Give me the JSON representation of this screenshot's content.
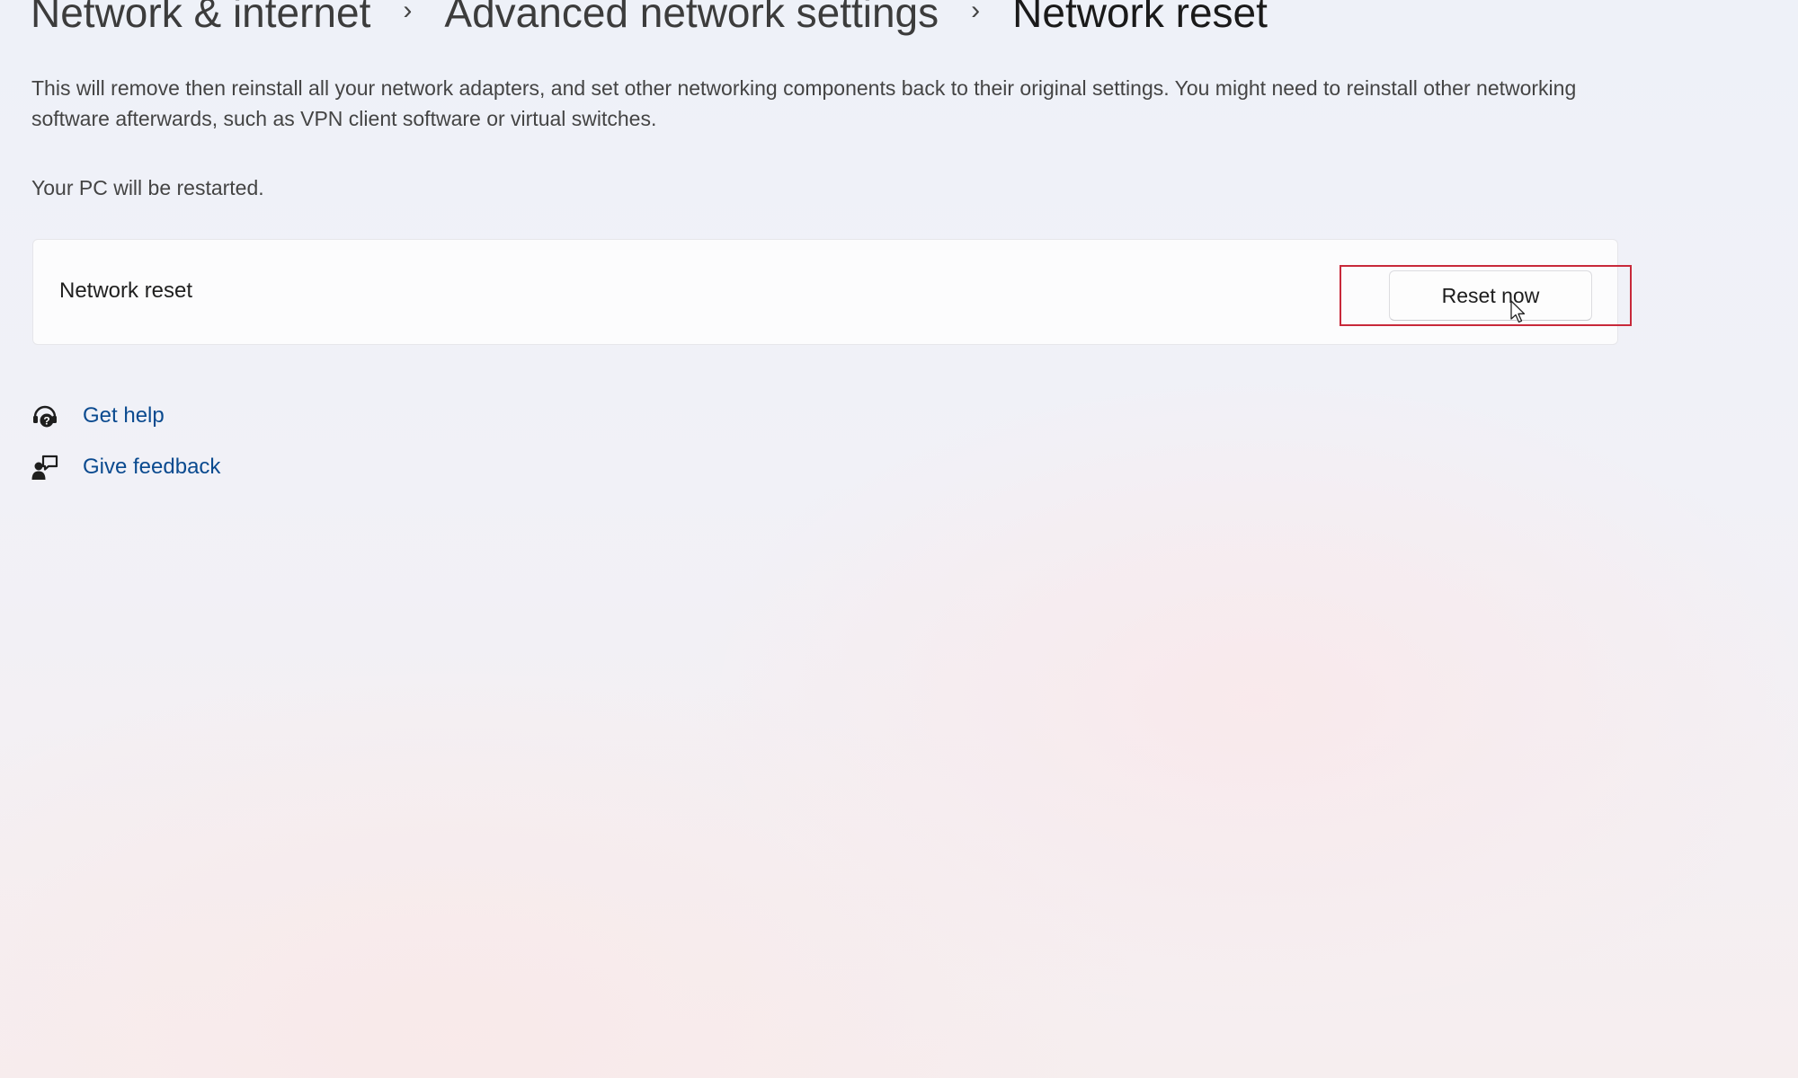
{
  "breadcrumb": {
    "items": [
      "Network & internet",
      "Advanced network settings",
      "Network reset"
    ],
    "separator": "›"
  },
  "description": "This will remove then reinstall all your network adapters, and set other networking components back to their original settings. You might need to reinstall other networking software afterwards, such as VPN client software or virtual switches.",
  "restart_note": "Your PC will be restarted.",
  "network_reset_card": {
    "label": "Network reset",
    "button_label": "Reset now"
  },
  "links": {
    "get_help": {
      "label": "Get help",
      "icon": "get-help-icon"
    },
    "give_feedback": {
      "label": "Give feedback",
      "icon": "feedback-icon"
    }
  },
  "colors": {
    "link": "#0a4a8f",
    "highlight_box": "#c8293a"
  }
}
